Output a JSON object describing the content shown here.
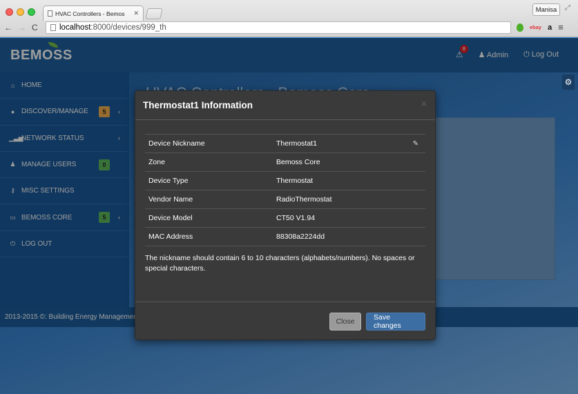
{
  "browser": {
    "tab_title": "HVAC Controllers - Bemos",
    "user_chip": "Manisa",
    "url_host": "localhost",
    "url_rest": ":8000/devices/999_th",
    "traffic_lights": [
      "#fc605b",
      "#fdbc40",
      "#34c84a"
    ]
  },
  "app": {
    "logo": "BEMOSS",
    "alert_count": "0",
    "admin_label": "Admin",
    "logout_label": "Log Out",
    "content_title": "HVAC Controllers - Bemoss Core",
    "footer": "2013-2015 ©: Building Energy Management Open Source Software."
  },
  "sidebar": {
    "items": [
      {
        "icon": "home-icon",
        "glyph": "⌂",
        "label": "HOME"
      },
      {
        "icon": "globe-icon",
        "glyph": "●",
        "label": "DISCOVER/MANAGE",
        "badge": "5",
        "badge_color": "#f0ad4e",
        "chevron": "‹"
      },
      {
        "icon": "signal-icon",
        "glyph": "▁▃▅",
        "label": "NETWORK STATUS",
        "chevron": "‹"
      },
      {
        "icon": "user-icon",
        "glyph": "♟",
        "label": "MANAGE USERS",
        "badge": "0",
        "badge_color": "#5cb85c"
      },
      {
        "icon": "key-icon",
        "glyph": "⚷",
        "label": "MISC SETTINGS"
      },
      {
        "icon": "monitor-icon",
        "glyph": "▭",
        "label": "BEMOSS CORE",
        "badge": "5",
        "badge_color": "#5cb85c",
        "chevron": "‹"
      },
      {
        "icon": "power-icon",
        "glyph": "⏻",
        "label": "LOG OUT"
      }
    ]
  },
  "modal": {
    "title": "Thermostat1 Information",
    "close_glyph": "×",
    "rows": [
      {
        "key": "Device Nickname",
        "value": "Thermostat1",
        "editable": true
      },
      {
        "key": "Zone",
        "value": "Bemoss Core"
      },
      {
        "key": "Device Type",
        "value": "Thermostat"
      },
      {
        "key": "Vendor Name",
        "value": "RadioThermostat"
      },
      {
        "key": "Device Model",
        "value": "CT50 V1.94"
      },
      {
        "key": "MAC Address",
        "value": "88308a2224dd"
      }
    ],
    "note": "The nickname should contain 6 to 10 characters (alphabets/numbers). No spaces or special characters.",
    "close_button": "Close",
    "save_button": "Save changes"
  }
}
